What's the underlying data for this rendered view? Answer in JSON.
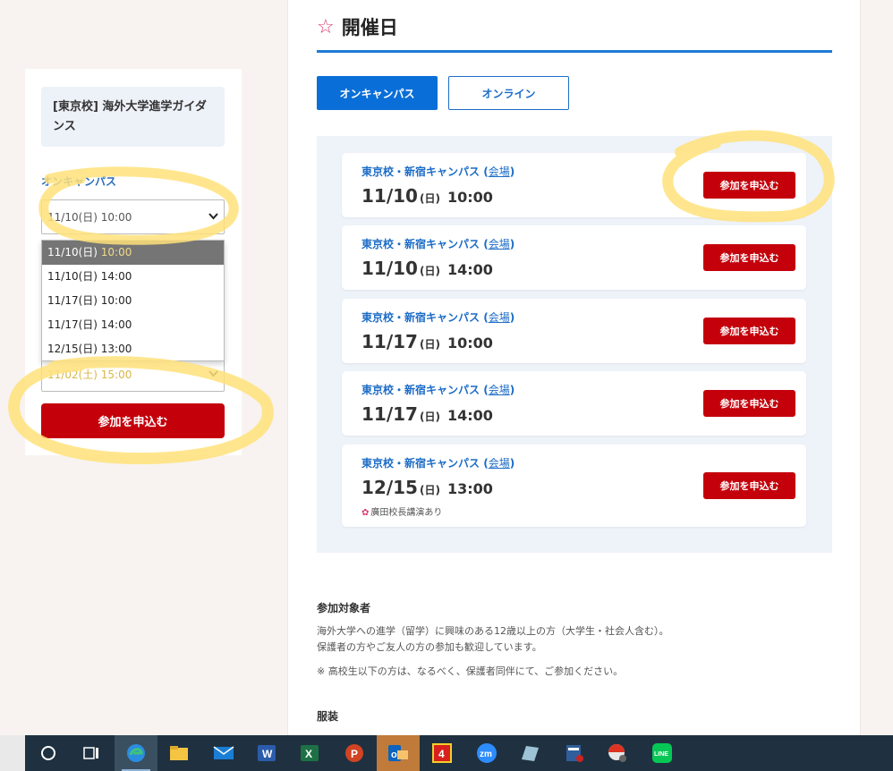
{
  "sidebar": {
    "event_title": "[東京校] 海外大学進学ガイダンス",
    "mode_label": "オンキャンパス",
    "selected_date": "11/10(日) 10:00",
    "dropdown_options": [
      {
        "date": "11/10(日)",
        "time": "10:00"
      },
      {
        "date": "11/10(日)",
        "time": "14:00"
      },
      {
        "date": "11/17(日)",
        "time": "10:00"
      },
      {
        "date": "11/17(日)",
        "time": "14:00"
      },
      {
        "date": "12/15(日)",
        "time": "13:00"
      }
    ],
    "second_select_value": "11/02(土) 15:00",
    "apply_label": "参加を申込む",
    "chevron_icon": "chevron-down-icon"
  },
  "main": {
    "heading": "開催日",
    "heading_icon": "star-outline-icon",
    "tabs": [
      {
        "label": "オンキャンパス",
        "active": true
      },
      {
        "label": "オンライン",
        "active": false
      }
    ],
    "sessions": [
      {
        "campus": "東京校・新宿キャンパス",
        "venue": "会場",
        "date": "11/10",
        "dow": "(日)",
        "time": "10:00",
        "note": "",
        "button": "参加を申込む"
      },
      {
        "campus": "東京校・新宿キャンパス",
        "venue": "会場",
        "date": "11/10",
        "dow": "(日)",
        "time": "14:00",
        "note": "",
        "button": "参加を申込む"
      },
      {
        "campus": "東京校・新宿キャンパス",
        "venue": "会場",
        "date": "11/17",
        "dow": "(日)",
        "time": "10:00",
        "note": "",
        "button": "参加を申込む"
      },
      {
        "campus": "東京校・新宿キャンパス",
        "venue": "会場",
        "date": "11/17",
        "dow": "(日)",
        "time": "14:00",
        "note": "",
        "button": "参加を申込む"
      },
      {
        "campus": "東京校・新宿キャンパス",
        "venue": "会場",
        "date": "12/15",
        "dow": "(日)",
        "time": "13:00",
        "note": "廣田校長講演あり",
        "button": "参加を申込む"
      }
    ],
    "target": {
      "heading": "参加対象者",
      "line1": "海外大学への進学（留学）に興味のある12歳以上の方（大学生・社会人含む）。",
      "line2": "保護者の方やご友人の方の参加も歓迎しています。",
      "line3": "※ 高校生以下の方は、なるべく、保護者同伴にて、ご参加ください。"
    },
    "dress_heading": "服装"
  },
  "colors": {
    "accent_blue": "#1f7ad6",
    "apply_red": "#c4000b",
    "star_pink": "#d9396d",
    "highlighter": "#ffe27a"
  },
  "taskbar": {
    "icons": [
      "cortana-icon",
      "task-view-icon",
      "edge-icon",
      "file-explorer-icon",
      "mail-icon",
      "word-icon",
      "excel-icon",
      "powerpoint-icon",
      "outlook-icon",
      "app-red-icon",
      "zoom-icon",
      "notes-icon",
      "database-icon",
      "camera-ball-icon",
      "line-icon"
    ],
    "zoom_label": "zm",
    "line_label": "LINE",
    "word_label": "W",
    "excel_label": "X",
    "ppt_label": "P",
    "outlook_label": "o",
    "red_app_label": "4"
  }
}
